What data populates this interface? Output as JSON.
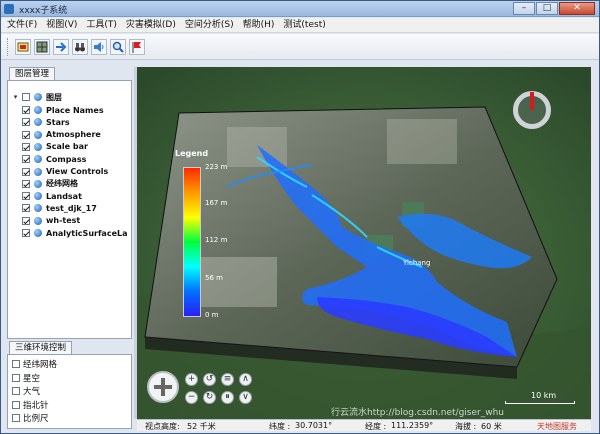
{
  "window": {
    "title": "xxxx子系统",
    "min_label": "–",
    "max_label": "□",
    "close_label": "✕"
  },
  "menu": [
    "文件(F)",
    "视图(V)",
    "工具(T)",
    "灾害模拟(D)",
    "空间分析(S)",
    "帮助(H)",
    "测试(test)"
  ],
  "toolbar": {
    "buttons": [
      "layer-icon",
      "grid-icon",
      "arrow-icon",
      "binoculars-icon",
      "speaker-icon",
      "magnifier-icon",
      "flag-icon"
    ]
  },
  "layer_panel": {
    "tab_label": "图层管理",
    "root_label": "图层",
    "items": [
      {
        "label": "Place Names",
        "checked": true
      },
      {
        "label": "Stars",
        "checked": true
      },
      {
        "label": "Atmosphere",
        "checked": true
      },
      {
        "label": "Scale bar",
        "checked": true
      },
      {
        "label": "Compass",
        "checked": true
      },
      {
        "label": "View Controls",
        "checked": true
      },
      {
        "label": "经纬网格",
        "checked": true
      },
      {
        "label": "Landsat",
        "checked": true
      },
      {
        "label": "test_djk_17",
        "checked": true
      },
      {
        "label": "wh-test",
        "checked": true
      },
      {
        "label": "AnalyticSurfaceLa",
        "checked": true
      }
    ]
  },
  "env_panel": {
    "tab_label": "三维环境控制",
    "items": [
      {
        "label": "经纬网格",
        "checked": false
      },
      {
        "label": "星空",
        "checked": false
      },
      {
        "label": "大气",
        "checked": false
      },
      {
        "label": "指北针",
        "checked": false
      },
      {
        "label": "比例尺",
        "checked": false
      }
    ]
  },
  "map": {
    "legend_title": "Legend",
    "legend_ticks": [
      "223 m",
      "167 m",
      "112 m",
      "56 m",
      "0 m"
    ],
    "scale_label": "10 km",
    "place_label": "Yichang",
    "colors": {
      "flood_deep": "#1b3dff",
      "flood_mid": "#1e8cff",
      "flood_shallow": "#18d8ff",
      "terrain_dark": "#3b4a36",
      "terrain_light": "#b8b9a8"
    }
  },
  "status": {
    "altitude_label": "视点高度:",
    "altitude_value": "52 千米",
    "lat_label": "纬度 :",
    "lat_value": "30.7031°",
    "lon_label": "经度 :",
    "lon_value": "111.2359°",
    "elev_label": "海拔 :",
    "elev_value": "60 米",
    "extra": "天地图服务"
  },
  "watermark": "行云流水http://blog.csdn.net/giser_whu"
}
